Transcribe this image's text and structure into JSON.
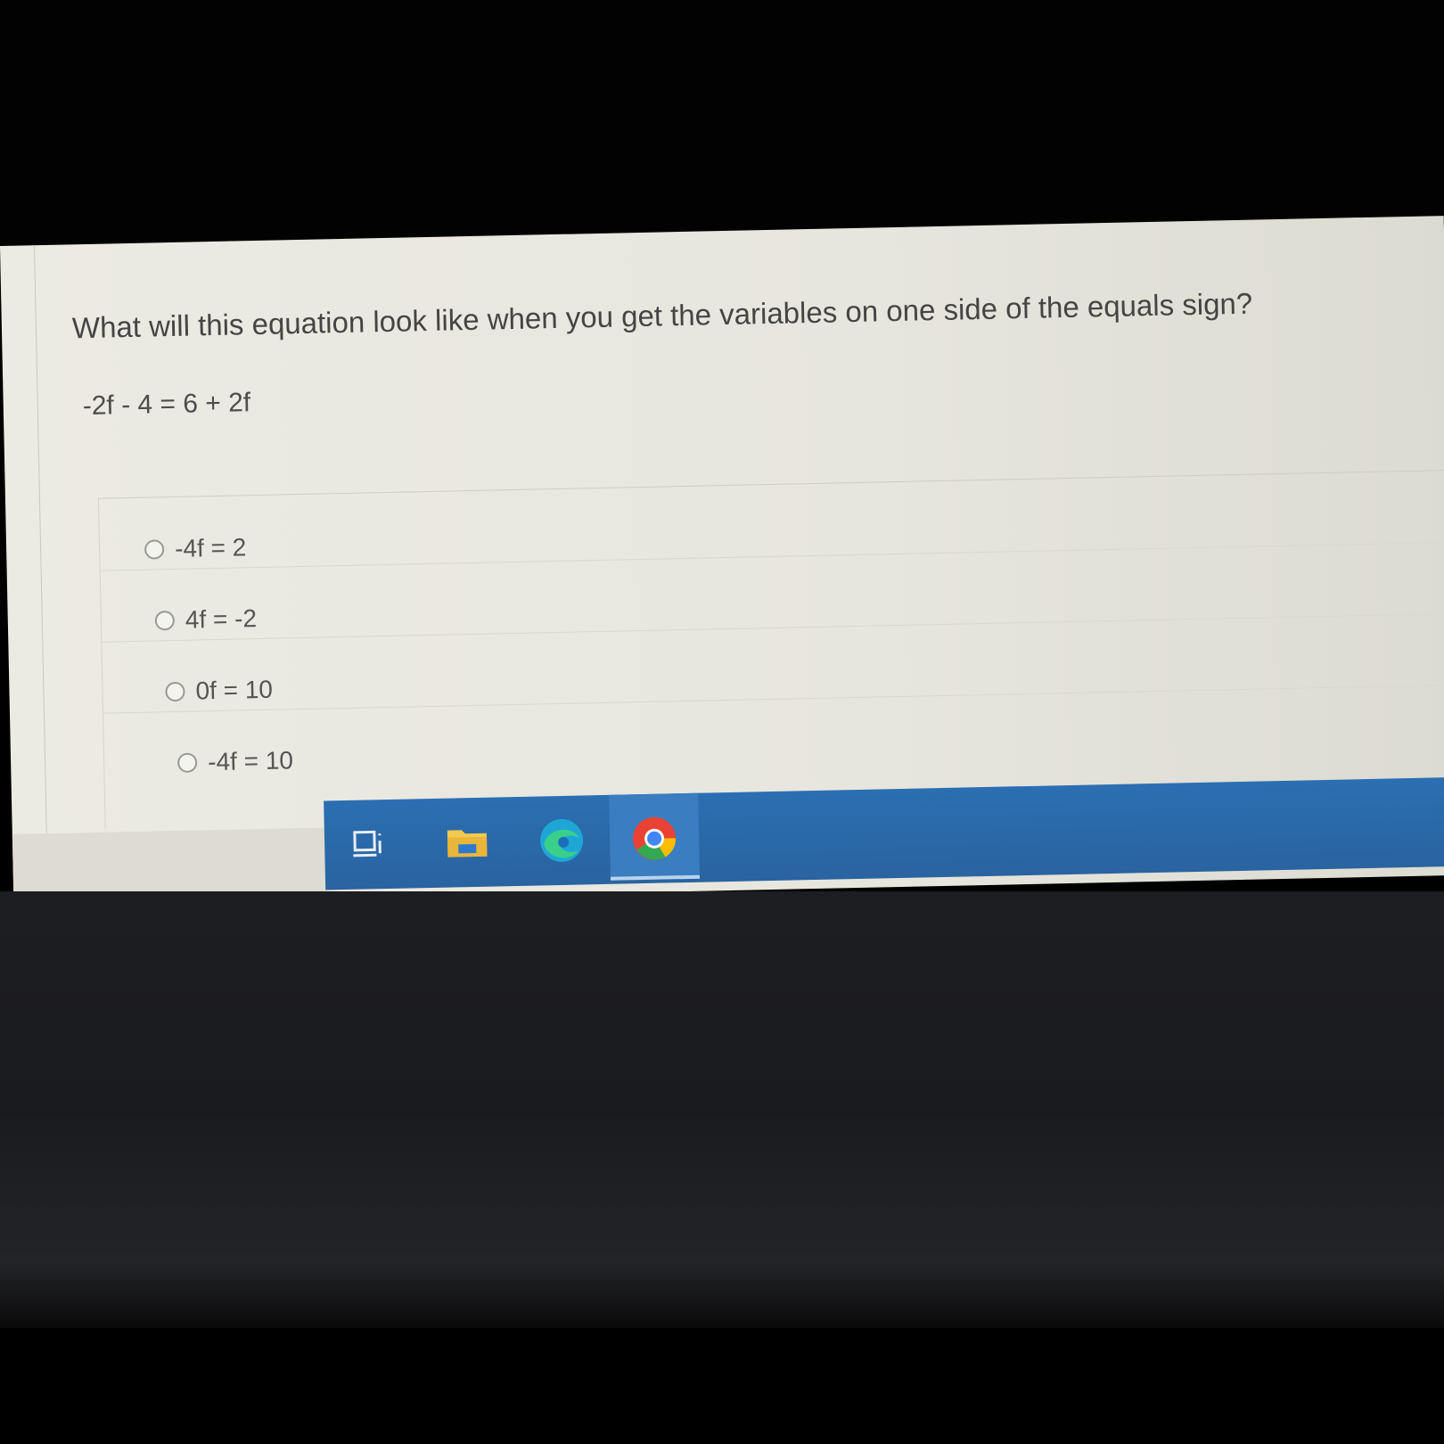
{
  "quiz": {
    "question": "What will this equation look like when you get the variables on one side of the equals sign?",
    "equation": "-2f - 4 = 6 + 2f",
    "options": [
      {
        "label": "-4f = 2",
        "selected": false
      },
      {
        "label": "4f = -2",
        "selected": false
      },
      {
        "label": "0f = 10",
        "selected": false
      },
      {
        "label": "-4f = 10",
        "selected": false
      }
    ]
  },
  "taskbar": {
    "icons": [
      "task-view-icon",
      "file-explorer-icon",
      "edge-browser-icon",
      "chrome-browser-icon"
    ],
    "active": "chrome-browser-icon"
  },
  "colors": {
    "page_background": "#ecebe3",
    "text": "#454545",
    "taskbar": "#2b6fb2"
  }
}
